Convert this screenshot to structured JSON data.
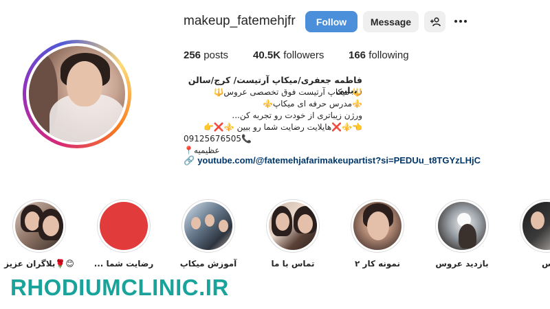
{
  "profile": {
    "username": "makeup_fatemehjfr",
    "follow_label": "Follow",
    "message_label": "Message",
    "adduser_icon": "➕👤",
    "posts_count": "256",
    "posts_label": "posts",
    "followers_count": "40.5K",
    "followers_label": "followers",
    "following_count": "166",
    "following_label": "following"
  },
  "bio": {
    "name": "فاطمه جعفری/میکاپ آرتیست/ کرج/سالن زیبایی",
    "lines": [
      "🔱 میکاپ آرتیست فوق تخصصی عروس🔱",
      "⚜️مدرس حرفه ای میکاپ⚜️",
      "ورژن زیباتری از خودت رو تجربه کن...",
      "👈⚜️❌هایلایت رضایت شما رو ببین ⚜️❌👉",
      "09125676505📞",
      "📍عظیمیه"
    ],
    "link": "youtube.com/@fatemehjafarimakeupartist?si=PEDUu_t8TGYzLHjC",
    "link_icon": "🔗"
  },
  "highlights": [
    {
      "label": "😊🌹بلاگران عزیز"
    },
    {
      "label": "رضایت شما ..."
    },
    {
      "label": "آموزش میکاپ"
    },
    {
      "label": "تماس با ما"
    },
    {
      "label": "نمونه کار ۲"
    },
    {
      "label": "بازدید عروس"
    },
    {
      "label": "💡🙃س"
    }
  ],
  "watermark": "RHODIUMCLINIC.IR",
  "colors": {
    "follow_button": "#4b8fdb",
    "secondary_button": "#efefef",
    "link": "#00376b",
    "watermark": "#1aa39a"
  }
}
